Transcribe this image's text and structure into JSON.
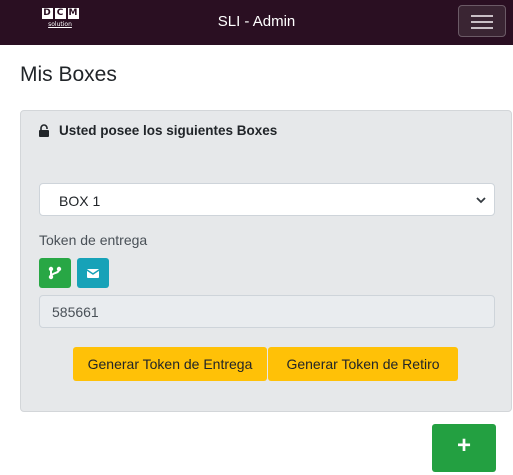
{
  "navbar": {
    "logo_letters": [
      "D",
      "C",
      "M"
    ],
    "logo_sub": "solution",
    "title": "SLI - Admin",
    "menu_icon": "hamburger-icon"
  },
  "page": {
    "title": "Mis Boxes"
  },
  "card": {
    "header_icon": "lock-icon",
    "header": "Usted posee los siguientes Boxes",
    "box_select": {
      "value": "BOX 1",
      "options": [
        "BOX 1"
      ]
    },
    "token_label": "Token de entrega",
    "share_icons": [
      "share-icon",
      "mail-icon"
    ],
    "token_value": "585661",
    "buttons": {
      "generar_entrega": "Generar Token de Entrega",
      "generar_retiro": "Generar Token de Retiro"
    }
  },
  "fab": {
    "label": "+"
  },
  "colors": {
    "navbar": "#2a0f22",
    "success": "#28a745",
    "info": "#17a2b8",
    "warning": "#ffc107",
    "card_bg": "#e6e8ea"
  }
}
